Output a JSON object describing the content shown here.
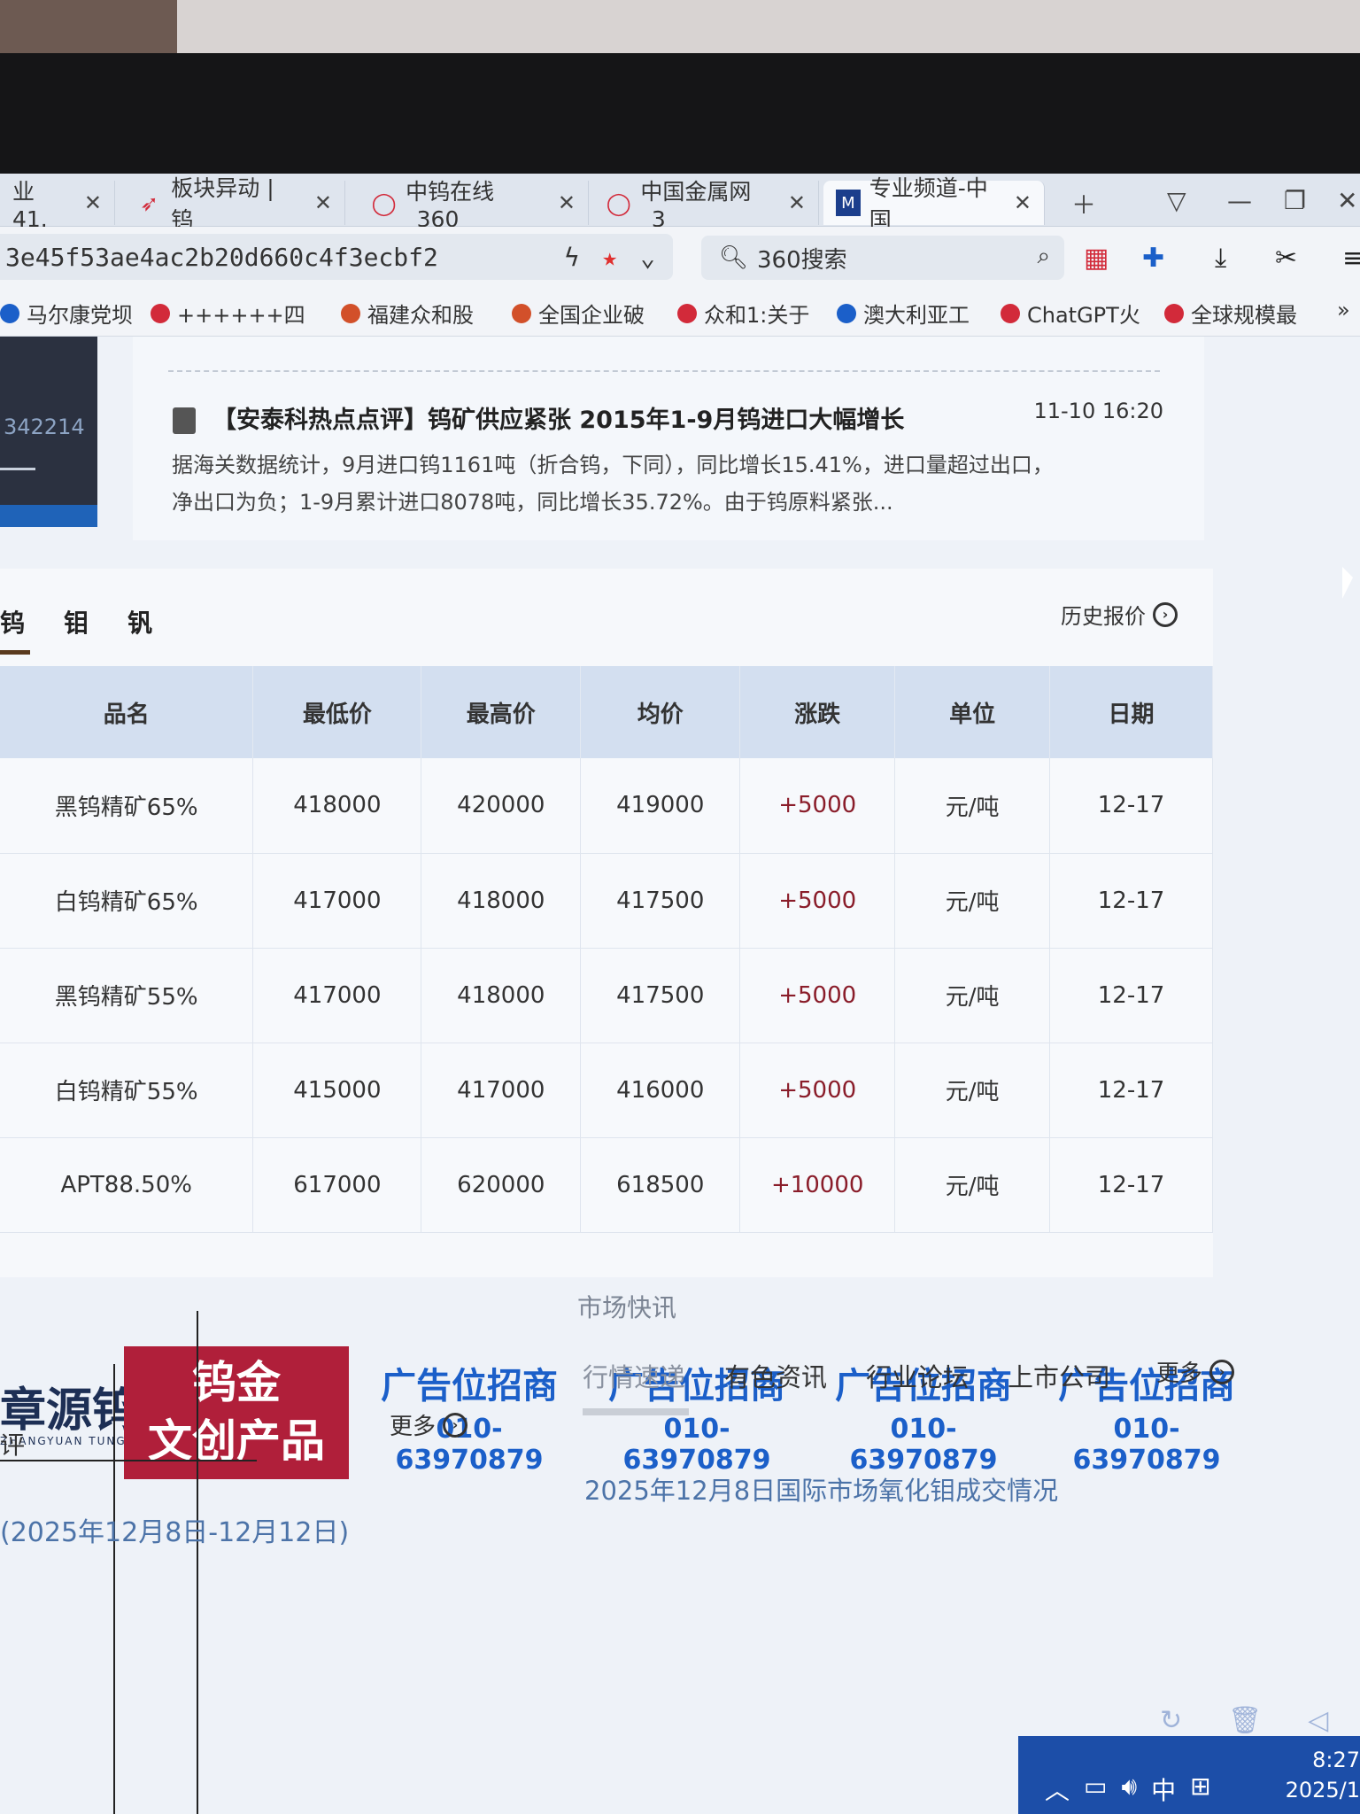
{
  "browser": {
    "tabs": [
      {
        "label": "业 41.",
        "icon": "page-icon"
      },
      {
        "label": "板块异动 | 钨",
        "icon": "bird-icon"
      },
      {
        "label": "中钨在线_360",
        "icon": "360-icon"
      },
      {
        "label": "中国金属网_3",
        "icon": "360-icon"
      },
      {
        "label": "专业频道-中国",
        "icon": "site-icon"
      }
    ],
    "url": "3e45f53ae4ac2b20d660c4f3ecbf2",
    "search_placeholder": "360搜索",
    "bookmarks": [
      "马尔康党坝",
      "++++++四",
      "福建众和股",
      "全国企业破",
      "众和1:关于",
      "澳大利亚工",
      "ChatGPT火",
      "全球规模最"
    ]
  },
  "left_banner": {
    "number": "342214"
  },
  "news": {
    "title": "【安泰科热点点评】钨矿供应紧张 2015年1-9月钨进口大幅增长",
    "time": "11-10 16:20",
    "body": "据海关数据统计，9月进口钨1161吨（折合钨，下同），同比增长15.41%，进口量超过出口，净出口为负；1-9月累计进口8078吨，同比增长35.72%。由于钨原料紧张..."
  },
  "prices": {
    "tabs": [
      "钨",
      "钼",
      "钒"
    ],
    "history_label": "历史报价",
    "columns": [
      "品名",
      "最低价",
      "最高价",
      "均价",
      "涨跌",
      "单位",
      "日期"
    ],
    "rows": [
      [
        "黑钨精矿65%",
        "418000",
        "420000",
        "419000",
        "+5000",
        "元/吨",
        "12-17"
      ],
      [
        "白钨精矿65%",
        "417000",
        "418000",
        "417500",
        "+5000",
        "元/吨",
        "12-17"
      ],
      [
        "黑钨精矿55%",
        "417000",
        "418000",
        "417500",
        "+5000",
        "元/吨",
        "12-17"
      ],
      [
        "白钨精矿55%",
        "415000",
        "417000",
        "416000",
        "+5000",
        "元/吨",
        "12-17"
      ],
      [
        "APT88.50%",
        "617000",
        "620000",
        "618500",
        "+10000",
        "元/吨",
        "12-17"
      ]
    ]
  },
  "ads": {
    "logo": "章源钨业",
    "logo_sub": "ZHANGYUAN TUNGSTEN",
    "red_line1": "钨金",
    "red_line2": "文创产品",
    "slot_title": "广告位招商",
    "slot_phone": "010-63970879"
  },
  "market": {
    "title": "市场快讯",
    "tabs": [
      "行情速递",
      "有色资讯",
      "行业论坛",
      "上市公司"
    ],
    "more": "更多",
    "item": "2025年12月8日国际市场氧化钼成交情况",
    "left_label": "评",
    "left_more": "更多",
    "left_item": "(2025年12月8日-12月12日)"
  },
  "taskbar": {
    "ime": "中",
    "time": "8:27",
    "date": "2025/1"
  },
  "colors": {
    "accent_blue": "#1b5fc9",
    "table_header": "#d3dff0",
    "change_red": "#8a1d2a",
    "ad_red": "#b01f3a"
  }
}
